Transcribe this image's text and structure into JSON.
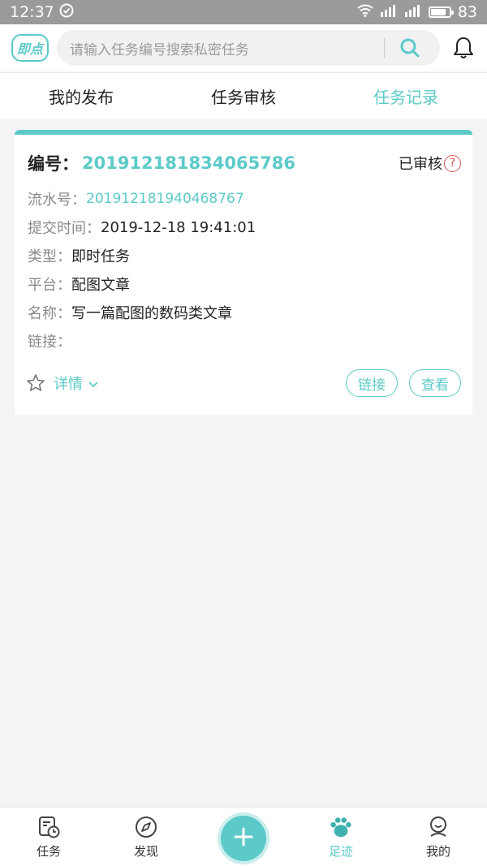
{
  "status_bar": {
    "time": "12:37",
    "battery": "83",
    "battery_level": 0.83
  },
  "header": {
    "logo": "即点",
    "search_placeholder": "请输入任务编号搜索私密任务"
  },
  "tabs": [
    {
      "label": "我的发布",
      "active": false
    },
    {
      "label": "任务审核",
      "active": false
    },
    {
      "label": "任务记录",
      "active": true
    }
  ],
  "card": {
    "number_label": "编号：",
    "number": "20191218183406​5786",
    "status": "已审核",
    "rows": [
      {
        "label": "流水号：",
        "value": "201912181940468767"
      },
      {
        "label": "提交时间：",
        "value": "2019-12-18 19:41:01"
      },
      {
        "label": "类型：",
        "value": "即时任务"
      },
      {
        "label": "平台：",
        "value": "配图文章"
      },
      {
        "label": "名称：",
        "value": "写一篇配图的数码类文章"
      },
      {
        "label": "链接：",
        "value": ""
      }
    ],
    "detail_label": "详情",
    "link_button": "链接",
    "view_button": "查看"
  },
  "nav": [
    {
      "label": "任务",
      "icon": "task-clock-icon",
      "active": false
    },
    {
      "label": "发现",
      "icon": "compass-icon",
      "active": false
    },
    {
      "label": "足迹",
      "icon": "paw-icon",
      "active": true
    },
    {
      "label": "我的",
      "icon": "profile-icon",
      "active": false
    }
  ],
  "colors": {
    "accent": "#5ccac8",
    "status_bar": "#9a9a9a",
    "question": "#d9534f"
  }
}
